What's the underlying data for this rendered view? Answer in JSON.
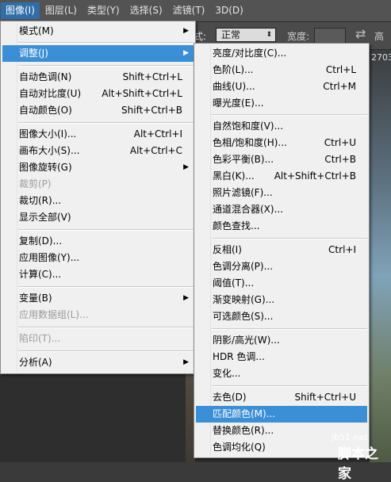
{
  "menubar": {
    "items": [
      "图像(I)",
      "图层(L)",
      "类型(Y)",
      "选择(S)",
      "滤镜(T)",
      "3D(D)"
    ]
  },
  "options_bar": {
    "mode_label": "式:",
    "mode_value": "正常",
    "width_label": "宽度:",
    "height_label": "高"
  },
  "canvas": {
    "readout": "2703"
  },
  "image_menu": {
    "items": [
      {
        "label": "模式(M)",
        "submenu": true
      },
      {
        "label": "调整(J)",
        "submenu": true,
        "highlighted": true
      },
      {
        "label": "自动色调(N)",
        "shortcut": "Shift+Ctrl+L"
      },
      {
        "label": "自动对比度(U)",
        "shortcut": "Alt+Shift+Ctrl+L"
      },
      {
        "label": "自动颜色(O)",
        "shortcut": "Shift+Ctrl+B"
      },
      {
        "label": "图像大小(I)...",
        "shortcut": "Alt+Ctrl+I"
      },
      {
        "label": "画布大小(S)...",
        "shortcut": "Alt+Ctrl+C"
      },
      {
        "label": "图像旋转(G)",
        "submenu": true
      },
      {
        "label": "裁剪(P)",
        "disabled": true
      },
      {
        "label": "裁切(R)..."
      },
      {
        "label": "显示全部(V)"
      },
      {
        "label": "复制(D)..."
      },
      {
        "label": "应用图像(Y)..."
      },
      {
        "label": "计算(C)..."
      },
      {
        "label": "变量(B)",
        "submenu": true
      },
      {
        "label": "应用数据组(L)...",
        "disabled": true
      },
      {
        "label": "陷印(T)...",
        "disabled": true
      },
      {
        "label": "分析(A)",
        "submenu": true
      }
    ]
  },
  "adjust_menu": {
    "items": [
      {
        "label": "亮度/对比度(C)..."
      },
      {
        "label": "色阶(L)...",
        "shortcut": "Ctrl+L"
      },
      {
        "label": "曲线(U)...",
        "shortcut": "Ctrl+M"
      },
      {
        "label": "曝光度(E)..."
      },
      {
        "label": "自然饱和度(V)..."
      },
      {
        "label": "色相/饱和度(H)...",
        "shortcut": "Ctrl+U"
      },
      {
        "label": "色彩平衡(B)...",
        "shortcut": "Ctrl+B"
      },
      {
        "label": "黑白(K)...",
        "shortcut": "Alt+Shift+Ctrl+B"
      },
      {
        "label": "照片滤镜(F)..."
      },
      {
        "label": "通道混合器(X)..."
      },
      {
        "label": "颜色查找..."
      },
      {
        "label": "反相(I)",
        "shortcut": "Ctrl+I"
      },
      {
        "label": "色调分离(P)..."
      },
      {
        "label": "阈值(T)..."
      },
      {
        "label": "渐变映射(G)..."
      },
      {
        "label": "可选颜色(S)..."
      },
      {
        "label": "阴影/高光(W)..."
      },
      {
        "label": "HDR 色调..."
      },
      {
        "label": "变化..."
      },
      {
        "label": "去色(D)",
        "shortcut": "Shift+Ctrl+U"
      },
      {
        "label": "匹配颜色(M)...",
        "highlighted": true
      },
      {
        "label": "替换颜色(R)..."
      },
      {
        "label": "色调均化(Q)"
      }
    ]
  },
  "watermark": {
    "site": "jb51.net",
    "brand": "脚本之家"
  },
  "colors": {
    "highlight": "#3b8fd6",
    "menu_bg": "#f0f0f0",
    "menubar_bg": "#535353"
  }
}
